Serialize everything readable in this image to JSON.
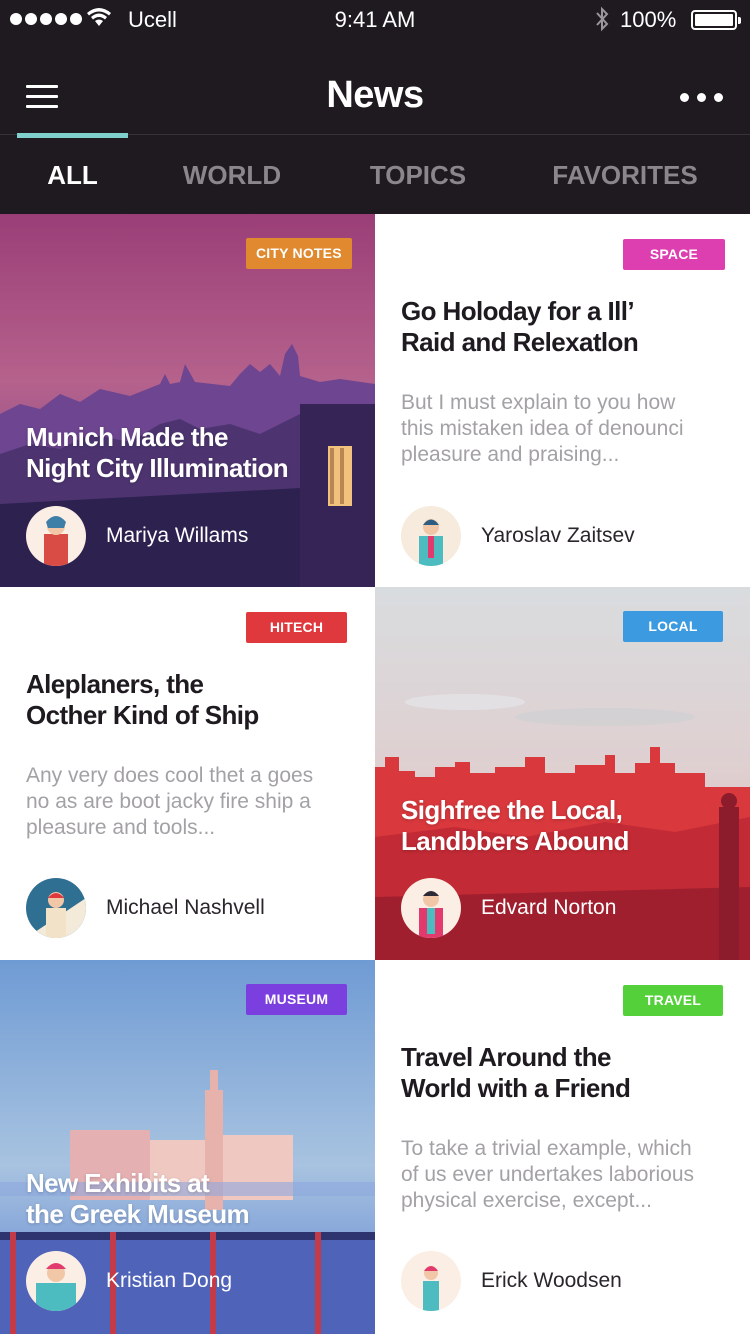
{
  "status_bar": {
    "carrier": "Ucell",
    "time": "9:41 AM",
    "battery": "100%"
  },
  "nav": {
    "title": "News"
  },
  "tabs": [
    {
      "label": "ALL",
      "active": true
    },
    {
      "label": "WORLD",
      "active": false
    },
    {
      "label": "TOPICS",
      "active": false
    },
    {
      "label": "FAVORITES",
      "active": false
    }
  ],
  "cards": [
    {
      "badge": "CITY NOTES",
      "badge_color": "#e0892f",
      "title_line1": "Munich Made the",
      "title_line2": "Night City Illumination",
      "author": "Mariya Willams",
      "style": "image"
    },
    {
      "badge": "SPACE",
      "badge_color": "#de3fb0",
      "title_line1": "Go Holoday for a Ill’",
      "title_line2": "Raid and Relexatlon",
      "excerpt_line1": "But I must explain to you how",
      "excerpt_line2": "this mistaken idea of denounci",
      "excerpt_line3": "pleasure and praising...",
      "author": "Yaroslav Zaitsev",
      "style": "white"
    },
    {
      "badge": "HITECH",
      "badge_color": "#e0393d",
      "title_line1": "Aleplaners, the",
      "title_line2": "Octher Kind of Ship",
      "excerpt_line1": "Any very does cool thet a goes",
      "excerpt_line2": "no as are boot jacky fire ship a",
      "excerpt_line3": "pleasure and tools...",
      "author": "Michael Nashvell",
      "style": "white"
    },
    {
      "badge": "LOCAL",
      "badge_color": "#3b9ae0",
      "title_line1": "Sighfree the Local,",
      "title_line2": "Landbbers Abound",
      "author": "Edvard Norton",
      "style": "image"
    },
    {
      "badge": "MUSEUM",
      "badge_color": "#7b3fe0",
      "title_line1": "New Exhibits at",
      "title_line2": "the Greek Museum",
      "author": "Kristian Dong",
      "style": "image"
    },
    {
      "badge": "TRAVEL",
      "badge_color": "#54d03b",
      "title_line1": "Travel Around the",
      "title_line2": "World with a Friend",
      "excerpt_line1": "To take a trivial example, which",
      "excerpt_line2": "of us ever undertakes laborious",
      "excerpt_line3": "physical exercise, except...",
      "author": "Erick Woodsen",
      "style": "white"
    }
  ]
}
